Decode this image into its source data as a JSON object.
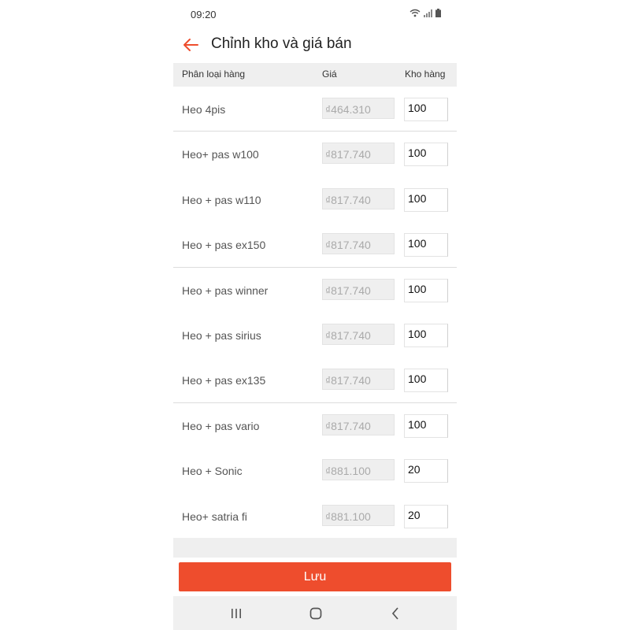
{
  "status": {
    "time": "09:20"
  },
  "header": {
    "title": "Chỉnh kho và giá bán"
  },
  "columns": {
    "name": "Phân loại hàng",
    "price": "Giá",
    "stock": "Kho hàng"
  },
  "rows": [
    {
      "name": "Heo 4pis",
      "price": "₫464.310",
      "stock": "100"
    },
    {
      "name": "Heo+ pas w100",
      "price": "₫817.740",
      "stock": "100"
    },
    {
      "name": "Heo + pas w110",
      "price": "₫817.740",
      "stock": "100"
    },
    {
      "name": "Heo + pas ex150",
      "price": "₫817.740",
      "stock": "100"
    },
    {
      "name": "Heo + pas winner",
      "price": "₫817.740",
      "stock": "100"
    },
    {
      "name": "Heo + pas sirius",
      "price": "₫817.740",
      "stock": "100"
    },
    {
      "name": "Heo + pas ex135",
      "price": "₫817.740",
      "stock": "100"
    },
    {
      "name": "Heo + pas vario",
      "price": "₫817.740",
      "stock": "100"
    },
    {
      "name": "Heo + Sonic",
      "price": "₫881.100",
      "stock": "20"
    },
    {
      "name": "Heo+ satria fi",
      "price": "₫881.100",
      "stock": "20"
    }
  ],
  "footer": {
    "save_label": "Lưu"
  },
  "colors": {
    "accent": "#ee4d2d"
  },
  "icons": {
    "back": "arrow-left-icon",
    "wifi": "wifi-icon",
    "signal": "signal-icon",
    "battery": "battery-icon",
    "recents": "recents-icon",
    "home": "home-icon",
    "nav_back": "nav-back-icon"
  }
}
